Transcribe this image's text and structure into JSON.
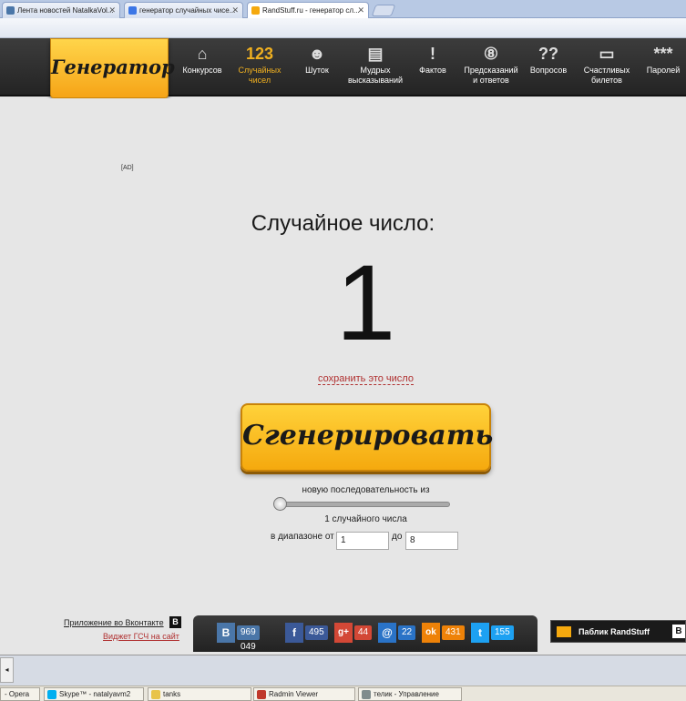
{
  "browser": {
    "tabs": [
      {
        "label": "Лента новостей NatalkaVol...",
        "fav_color": "#4a76a8"
      },
      {
        "label": "генератор случайных чисе...",
        "fav_color": "#3b76e6"
      },
      {
        "label": "RandStuff.ru - генератор сл...",
        "fav_color": "#f5a90e"
      }
    ]
  },
  "site": {
    "logo": "Генератор",
    "nav": [
      {
        "icon": "gift-icon",
        "glyph": "⌂",
        "label": "Конкурсов"
      },
      {
        "icon": "numbers-icon",
        "glyph": "123",
        "label": "Случайных\nчисел"
      },
      {
        "icon": "smiley-icon",
        "glyph": "☻",
        "label": "Шуток"
      },
      {
        "icon": "quote-icon",
        "glyph": "▤",
        "label": "Мудрых\nвысказываний"
      },
      {
        "icon": "alert-icon",
        "glyph": "!",
        "label": "Фактов"
      },
      {
        "icon": "magic-ball-icon",
        "glyph": "⑧",
        "label": "Предсказаний\nи ответов"
      },
      {
        "icon": "questions-icon",
        "glyph": "??",
        "label": "Вопросов"
      },
      {
        "icon": "ticket-icon",
        "glyph": "▭",
        "label": "Счастливых\nбилетов"
      },
      {
        "icon": "password-icon",
        "glyph": "***",
        "label": "Паролей"
      }
    ]
  },
  "main": {
    "ad": "[AD]",
    "title": "Случайное число:",
    "result": "1",
    "save_link": "сохранить это число",
    "generate_button": "Сгенерировать",
    "sequence_label": "новую последовательность из",
    "count_label": "1 случайного числа",
    "range_label": "в диапазоне от",
    "range_to_label": "до",
    "range_from": "1",
    "range_to": "8",
    "slider_fraction": 0
  },
  "footer": {
    "vk_app": "Приложение во Вконтакте",
    "vk_b": "B",
    "widget": "Виджет ГСЧ на сайт",
    "social": [
      {
        "name": "vk-share",
        "glyph": "B",
        "count": "969 049",
        "color": "#4a76a8"
      },
      {
        "name": "facebook-share",
        "glyph": "f",
        "count": "495",
        "color": "#3b5998"
      },
      {
        "name": "googleplus-share",
        "glyph": "g+",
        "count": "44",
        "color": "#d34836"
      },
      {
        "name": "mail-share",
        "glyph": "@",
        "count": "22",
        "color": "#2a73c7"
      },
      {
        "name": "ok-share",
        "glyph": "ok",
        "count": "431",
        "color": "#ee8208"
      },
      {
        "name": "twitter-share",
        "glyph": "t",
        "count": "155",
        "color": "#1da1f2"
      }
    ],
    "public": "Паблик RandStuff",
    "public_b": "B"
  },
  "taskbar": [
    {
      "label": "- Opera",
      "color": "#c0392b"
    },
    {
      "label": "Skype™ - natalyavm2",
      "color": "#00aff0"
    },
    {
      "label": "tanks",
      "color": "#e8c34a"
    },
    {
      "label": "Radmin Viewer",
      "color": "#c0392b"
    },
    {
      "label": "телик - Управление",
      "color": "#7f8c8d"
    }
  ]
}
